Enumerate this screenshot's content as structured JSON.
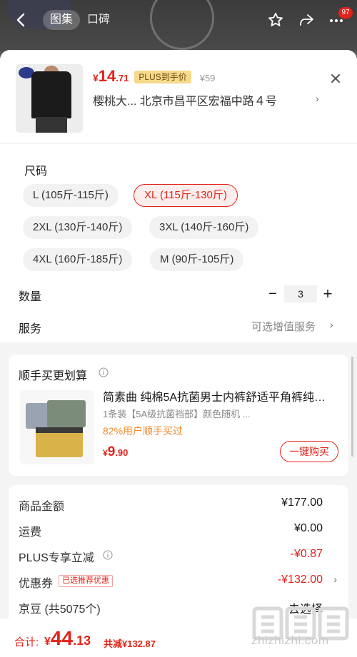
{
  "header": {
    "tabs": [
      {
        "label": "图集"
      },
      {
        "label": "口碑"
      }
    ],
    "badge_count": "97"
  },
  "sku": {
    "price_symbol": "¥",
    "price_int": "14",
    "price_dec": ".71",
    "plus_tag": "PLUS到手价",
    "original_price": "¥59",
    "address": "樱桃大...  北京市昌平区宏福中路４号"
  },
  "size": {
    "title": "尺码",
    "options": [
      {
        "label": "L (105斤-115斤)"
      },
      {
        "label": "XL (115斤-130斤)"
      },
      {
        "label": "2XL (130斤-140斤)"
      },
      {
        "label": "3XL (140斤-160斤)"
      },
      {
        "label": "4XL (160斤-185斤)"
      },
      {
        "label": "M (90斤-105斤)"
      }
    ],
    "selected": "XL (115斤-130斤)"
  },
  "quantity": {
    "label": "数量",
    "minus": "−",
    "value": "3",
    "plus": "+"
  },
  "service": {
    "label": "服务",
    "value": "可选增值服务"
  },
  "combo": {
    "title": "顺手买更划算",
    "product_name": "简素曲 纯棉5A抗菌男士内裤舒适平角裤纯…",
    "spec": "1条装【5A级抗菌裆部】颜色随机",
    "spec_more": "...",
    "rate": "82%用户顺手买过",
    "price_symbol": "¥",
    "price_int": "9",
    "price_dec": ".90",
    "buy_label": "一键购买"
  },
  "summary": {
    "rows": [
      {
        "label": "商品金额",
        "value": "¥177.00"
      },
      {
        "label": "运费",
        "value": "¥0.00"
      },
      {
        "label": "PLUS专享立减",
        "value": "-¥0.87"
      },
      {
        "label": "优惠券",
        "tag": "已选推荐优惠",
        "value": "-¥132.00"
      },
      {
        "label": "京豆 (共5075个)",
        "value": "去选择"
      }
    ]
  },
  "bottom": {
    "total_label": "合计:",
    "total_symbol": "¥",
    "total_int": "44",
    "total_dec": ".13",
    "discount": "共减¥132.87"
  },
  "watermark": {
    "text": "zhizhizhi.com"
  },
  "colors": {
    "accent": "#e2231a",
    "plus_gold": "#f7d98a",
    "orange": "#f08a2c",
    "background": "#f4f4f4"
  }
}
